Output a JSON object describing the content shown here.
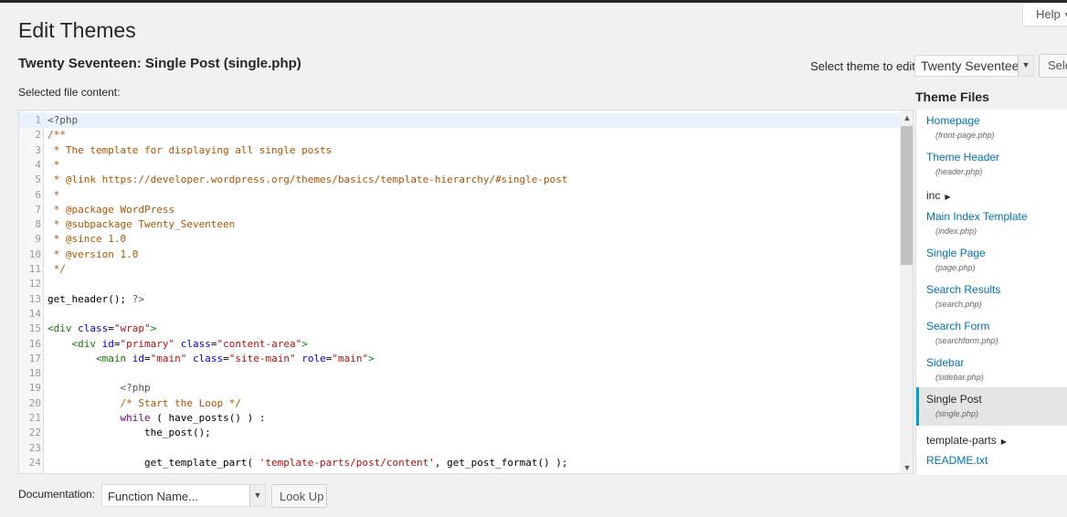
{
  "header": {
    "help_label": "Help",
    "page_title": "Edit Themes",
    "file_title": "Twenty Seventeen: Single Post (single.php)",
    "select_theme_label": "Select theme to edit:",
    "selected_theme": "Twenty Seventeen",
    "select_button": "Select"
  },
  "editor": {
    "label": "Selected file content:",
    "active_line": 1,
    "lines": [
      {
        "n": "1",
        "tokens": [
          {
            "t": "<?php",
            "c": "c-meta"
          }
        ]
      },
      {
        "n": "2",
        "tokens": [
          {
            "t": "/**",
            "c": "c-comment"
          }
        ]
      },
      {
        "n": "3",
        "tokens": [
          {
            "t": " * The template for displaying all single posts",
            "c": "c-comment"
          }
        ]
      },
      {
        "n": "4",
        "tokens": [
          {
            "t": " *",
            "c": "c-comment"
          }
        ]
      },
      {
        "n": "5",
        "tokens": [
          {
            "t": " * @link https://developer.wordpress.org/themes/basics/template-hierarchy/#single-post",
            "c": "c-comment"
          }
        ]
      },
      {
        "n": "6",
        "tokens": [
          {
            "t": " *",
            "c": "c-comment"
          }
        ]
      },
      {
        "n": "7",
        "tokens": [
          {
            "t": " * @package WordPress",
            "c": "c-comment"
          }
        ]
      },
      {
        "n": "8",
        "tokens": [
          {
            "t": " * @subpackage Twenty_Seventeen",
            "c": "c-comment"
          }
        ]
      },
      {
        "n": "9",
        "tokens": [
          {
            "t": " * @since 1.0",
            "c": "c-comment"
          }
        ]
      },
      {
        "n": "10",
        "tokens": [
          {
            "t": " * @version 1.0",
            "c": "c-comment"
          }
        ]
      },
      {
        "n": "11",
        "tokens": [
          {
            "t": " */",
            "c": "c-comment"
          }
        ]
      },
      {
        "n": "12",
        "tokens": []
      },
      {
        "n": "13",
        "tokens": [
          {
            "t": "get_header(); ",
            "c": ""
          },
          {
            "t": "?>",
            "c": "c-meta"
          }
        ]
      },
      {
        "n": "14",
        "tokens": []
      },
      {
        "n": "15",
        "tokens": [
          {
            "t": "<div ",
            "c": "c-tag"
          },
          {
            "t": "class",
            "c": "c-attr"
          },
          {
            "t": "=",
            "c": ""
          },
          {
            "t": "\"wrap\"",
            "c": "c-str"
          },
          {
            "t": ">",
            "c": "c-tag"
          }
        ]
      },
      {
        "n": "16",
        "tokens": [
          {
            "t": "    ",
            "c": ""
          },
          {
            "t": "<div ",
            "c": "c-tag"
          },
          {
            "t": "id",
            "c": "c-attr"
          },
          {
            "t": "=",
            "c": ""
          },
          {
            "t": "\"primary\"",
            "c": "c-str"
          },
          {
            "t": " ",
            "c": ""
          },
          {
            "t": "class",
            "c": "c-attr"
          },
          {
            "t": "=",
            "c": ""
          },
          {
            "t": "\"content-area\"",
            "c": "c-str"
          },
          {
            "t": ">",
            "c": "c-tag"
          }
        ]
      },
      {
        "n": "17",
        "tokens": [
          {
            "t": "        ",
            "c": ""
          },
          {
            "t": "<main ",
            "c": "c-tag"
          },
          {
            "t": "id",
            "c": "c-attr"
          },
          {
            "t": "=",
            "c": ""
          },
          {
            "t": "\"main\"",
            "c": "c-str"
          },
          {
            "t": " ",
            "c": ""
          },
          {
            "t": "class",
            "c": "c-attr"
          },
          {
            "t": "=",
            "c": ""
          },
          {
            "t": "\"site-main\"",
            "c": "c-str"
          },
          {
            "t": " ",
            "c": ""
          },
          {
            "t": "role",
            "c": "c-attr"
          },
          {
            "t": "=",
            "c": ""
          },
          {
            "t": "\"main\"",
            "c": "c-str"
          },
          {
            "t": ">",
            "c": "c-tag"
          }
        ]
      },
      {
        "n": "18",
        "tokens": []
      },
      {
        "n": "19",
        "tokens": [
          {
            "t": "            ",
            "c": ""
          },
          {
            "t": "<?php",
            "c": "c-meta"
          }
        ]
      },
      {
        "n": "20",
        "tokens": [
          {
            "t": "            ",
            "c": ""
          },
          {
            "t": "/* Start the Loop */",
            "c": "c-comment"
          }
        ]
      },
      {
        "n": "21",
        "tokens": [
          {
            "t": "            ",
            "c": ""
          },
          {
            "t": "while",
            "c": "c-kw"
          },
          {
            "t": " ( have_posts() ) :",
            "c": ""
          }
        ]
      },
      {
        "n": "22",
        "tokens": [
          {
            "t": "                the_post();",
            "c": ""
          }
        ]
      },
      {
        "n": "23",
        "tokens": []
      },
      {
        "n": "24",
        "tokens": [
          {
            "t": "                get_template_part( ",
            "c": ""
          },
          {
            "t": "'template-parts/post/content'",
            "c": "c-str"
          },
          {
            "t": ", get_post_format() );",
            "c": ""
          }
        ]
      }
    ]
  },
  "sidebar": {
    "title": "Theme Files",
    "items": [
      {
        "name": "Homepage",
        "path": "(front-page.php)"
      },
      {
        "name": "Theme Header",
        "path": "(header.php)"
      },
      {
        "name": "inc",
        "dir": true
      },
      {
        "name": "Main Index Template",
        "path": "(index.php)"
      },
      {
        "name": "Single Page",
        "path": "(page.php)"
      },
      {
        "name": "Search Results",
        "path": "(search.php)"
      },
      {
        "name": "Search Form",
        "path": "(searchform.php)"
      },
      {
        "name": "Sidebar",
        "path": "(sidebar.php)"
      },
      {
        "name": "Single Post",
        "path": "(single.php)",
        "current": true
      },
      {
        "name": "template-parts",
        "dir": true
      },
      {
        "name": "README.txt"
      }
    ]
  },
  "footer": {
    "documentation_label": "Documentation:",
    "function_select_value": "Function Name...",
    "lookup_button": "Look Up"
  }
}
